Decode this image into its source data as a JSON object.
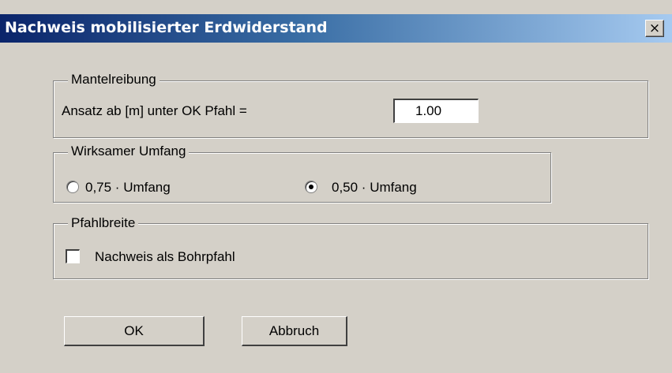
{
  "window": {
    "title": "Nachweis mobilisierter Erdwiderstand",
    "close_label": "×"
  },
  "mantelreibung": {
    "legend": "Mantelreibung",
    "label": "Ansatz ab [m] unter OK Pfahl =",
    "value": "1.00"
  },
  "umfang": {
    "legend": "Wirksamer Umfang",
    "options": [
      {
        "label": "0,75 · Umfang",
        "selected": false
      },
      {
        "label": "0,50 · Umfang",
        "selected": true
      }
    ]
  },
  "pfahlbreite": {
    "legend": "Pfahlbreite",
    "checkbox_label": "Nachweis als Bohrpfahl",
    "checked": false
  },
  "buttons": {
    "ok": "OK",
    "cancel": "Abbruch"
  },
  "colors": {
    "dialog_bg": "#d4d0c8",
    "title_gradient_start": "#0a246a",
    "title_gradient_end": "#a6caf0"
  }
}
